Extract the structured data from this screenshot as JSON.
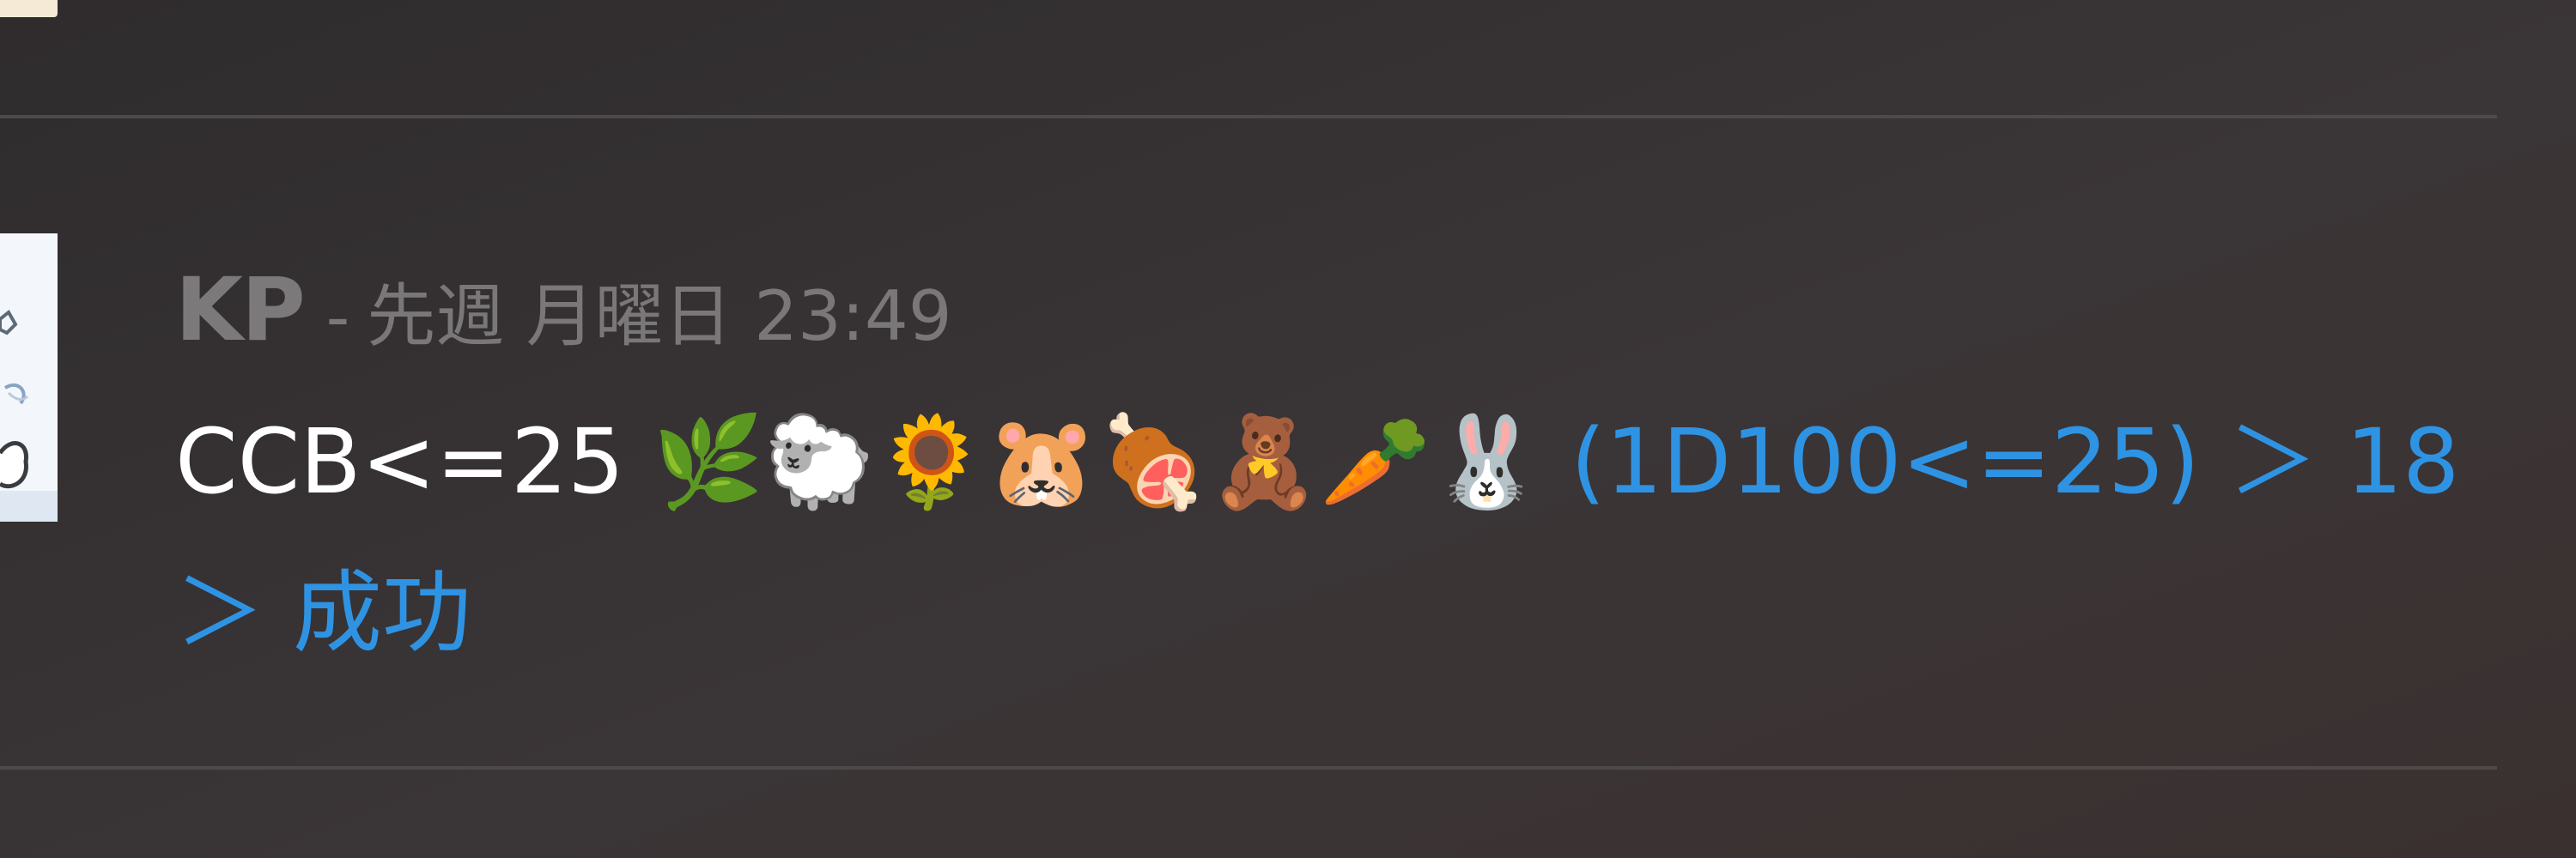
{
  "message": {
    "username": "KP",
    "separator": "-",
    "timestamp": "先週 月曜日 23:49",
    "command": "CCB<=25",
    "emojis": "🌿🐑🌻🐹🍖🧸🥕🐰",
    "result": "(1D100<=25) ＞ 18 ＞ 成功"
  },
  "colors": {
    "background": "#353032",
    "username": "#7c797b",
    "timestamp": "#7a7778",
    "text": "#ffffff",
    "result": "#2f93e3",
    "divider": "#4d4a4c"
  }
}
